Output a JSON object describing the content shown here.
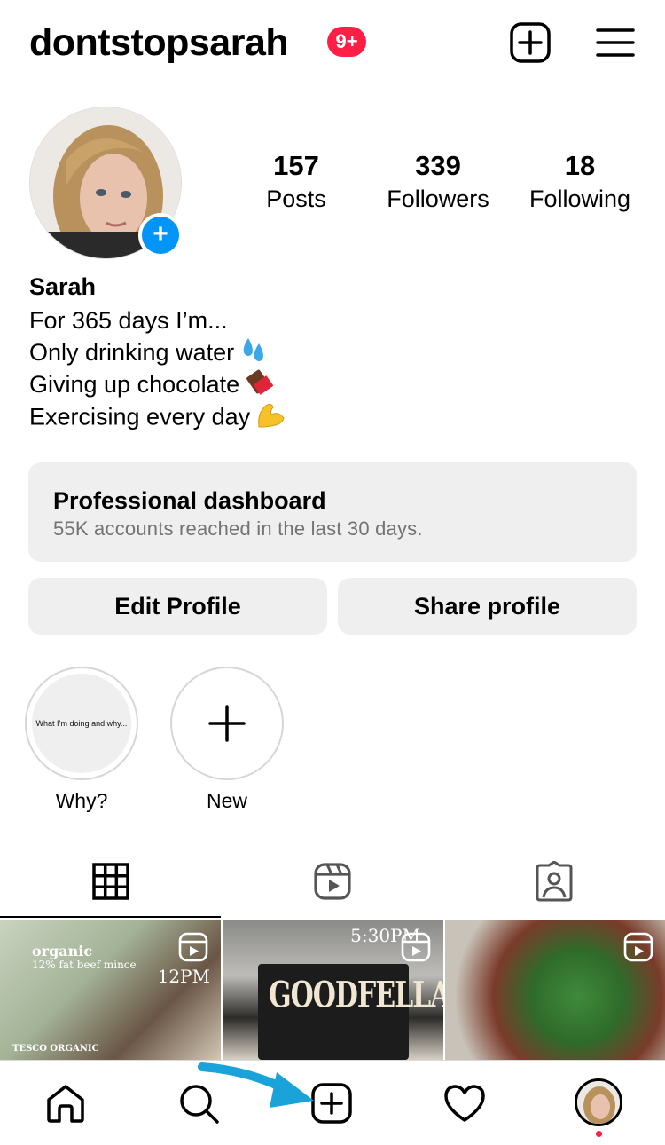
{
  "header": {
    "username": "dontstopsarah",
    "notification_badge": "9+",
    "new_post_icon": "plus-square-icon",
    "menu_icon": "hamburger-menu-icon"
  },
  "profile": {
    "stats": {
      "posts_count": "157",
      "posts_label": "Posts",
      "followers_count": "339",
      "followers_label": "Followers",
      "following_count": "18",
      "following_label": "Following"
    },
    "display_name": "Sarah",
    "bio": [
      "For 365 days I’m...",
      "Only drinking water",
      "Giving up chocolate",
      "Exercising every day"
    ],
    "bio_emojis": [
      "sweat-droplets-emoji",
      "chocolate-bar-emoji",
      "flexed-biceps-emoji"
    ]
  },
  "dashboard": {
    "title": "Professional dashboard",
    "subtitle": "55K accounts reached in the last 30 days."
  },
  "buttons": {
    "edit_profile": "Edit Profile",
    "share_profile": "Share profile"
  },
  "highlights": [
    {
      "label": "Why?",
      "cover_text": "What I’m doing and why..."
    },
    {
      "label": "New"
    }
  ],
  "tabs": [
    "grid-icon",
    "reels-icon",
    "tagged-icon"
  ],
  "posts": [
    {
      "type": "reel",
      "overlay_text": [
        "organic",
        "12% fat beef mince",
        "12PM",
        "TESCO ORGANIC"
      ]
    },
    {
      "type": "reel",
      "overlay_text": [
        "5:30PM",
        "GOODFELLA'S"
      ]
    },
    {
      "type": "reel",
      "overlay_text": []
    }
  ],
  "bottom_nav": [
    "home-icon",
    "search-icon",
    "create-icon",
    "heart-icon",
    "profile-avatar"
  ],
  "colors": {
    "badge_red": "#ff1e46",
    "blue": "#0095f6",
    "button_gray": "#efefef",
    "muted_text": "#737373",
    "annotation_arrow": "#1aa3d9"
  }
}
